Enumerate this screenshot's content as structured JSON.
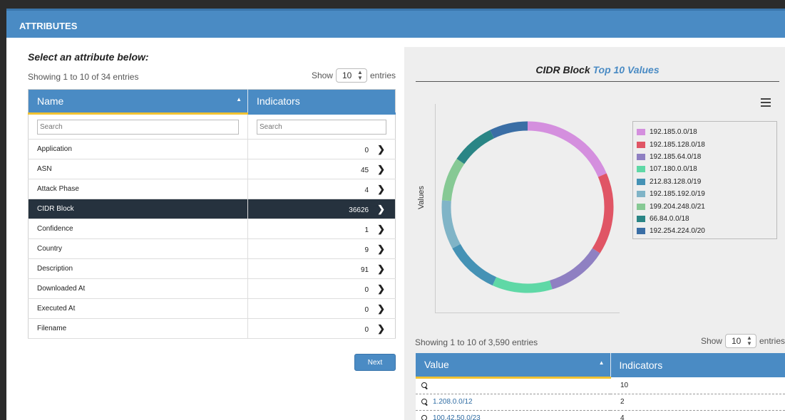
{
  "panel": {
    "title": "ATTRIBUTES"
  },
  "left": {
    "heading": "Select an attribute below:",
    "showing": "Showing 1 to 10 of 34 entries",
    "show_label": "Show",
    "show_value": "10",
    "entries_label": "entries",
    "columns": {
      "name": "Name",
      "indicators": "Indicators"
    },
    "search_placeholder_name": "Search",
    "search_placeholder_indicators": "Search",
    "rows": [
      {
        "name": "Application",
        "count": "0"
      },
      {
        "name": "ASN",
        "count": "45"
      },
      {
        "name": "Attack Phase",
        "count": "4"
      },
      {
        "name": "CIDR Block",
        "count": "36626"
      },
      {
        "name": "Confidence",
        "count": "1"
      },
      {
        "name": "Country",
        "count": "9"
      },
      {
        "name": "Description",
        "count": "91"
      },
      {
        "name": "Downloaded At",
        "count": "0"
      },
      {
        "name": "Executed At",
        "count": "0"
      },
      {
        "name": "Filename",
        "count": "0"
      }
    ],
    "selected_row": "CIDR Block",
    "next_label": "Next"
  },
  "chart": {
    "title_main": "CIDR Block",
    "title_accent": "Top 10 Values",
    "ylabel": "Values"
  },
  "chart_data": {
    "type": "pie",
    "title": "CIDR Block Top 10 Values",
    "ylabel": "Values",
    "legend_position": "right",
    "series": [
      {
        "name": "192.185.0.0/18",
        "value": 18,
        "color": "#d48fde"
      },
      {
        "name": "192.185.128.0/18",
        "value": 15,
        "color": "#e05565"
      },
      {
        "name": "192.185.64.0/18",
        "value": 11,
        "color": "#8f80c2"
      },
      {
        "name": "107.180.0.0/18",
        "value": 11,
        "color": "#5fd8a6"
      },
      {
        "name": "212.83.128.0/19",
        "value": 10,
        "color": "#4592b5"
      },
      {
        "name": "192.185.192.0/19",
        "value": 9,
        "color": "#80b4c7"
      },
      {
        "name": "199.204.248.0/21",
        "value": 8,
        "color": "#86c994"
      },
      {
        "name": "66.84.0.0/18",
        "value": 8,
        "color": "#2a8585"
      },
      {
        "name": "192.254.224.0/20",
        "value": 7,
        "color": "#3a6ea5"
      }
    ]
  },
  "values_table": {
    "showing": "Showing 1 to 10 of 3,590 entries",
    "show_label": "Show",
    "show_value": "10",
    "entries_label": "entries",
    "columns": {
      "value": "Value",
      "indicators": "Indicators"
    },
    "rows": [
      {
        "value": "",
        "count": "10"
      },
      {
        "value": "1.208.0.0/12",
        "count": "2"
      },
      {
        "value": "100.42.50.0/23",
        "count": "4"
      }
    ]
  }
}
